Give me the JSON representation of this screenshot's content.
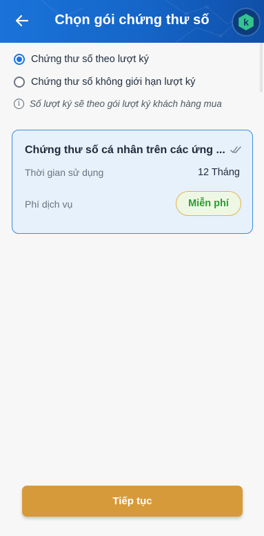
{
  "header": {
    "title": "Chọn gói chứng thư số",
    "logo_letter": "k",
    "back_icon": "arrow-left-icon",
    "logo_icon": "hexagon-logo-icon",
    "colors": {
      "header_blue": "#1a73d9",
      "logo_green": "#34c38f"
    }
  },
  "options": {
    "radio_1": {
      "label": "Chứng thư số theo lượt ký",
      "checked": true
    },
    "radio_2": {
      "label": "Chứng thư số không giới hạn lượt ký",
      "checked": false
    }
  },
  "note": {
    "icon": "info-icon",
    "text": "Số lượt ký sẽ theo gói lượt ký khách hàng mua"
  },
  "card": {
    "title": "Chứng thư số cá nhân trên các ứng ...",
    "check_icon": "double-check-icon",
    "duration_label": "Thời gian sử dụng",
    "duration_value": "12 Tháng",
    "fee_label": "Phí dịch vụ",
    "fee_value": "Miễn phí"
  },
  "footer": {
    "continue_label": "Tiếp tục",
    "button_color": "#d79a3a"
  }
}
